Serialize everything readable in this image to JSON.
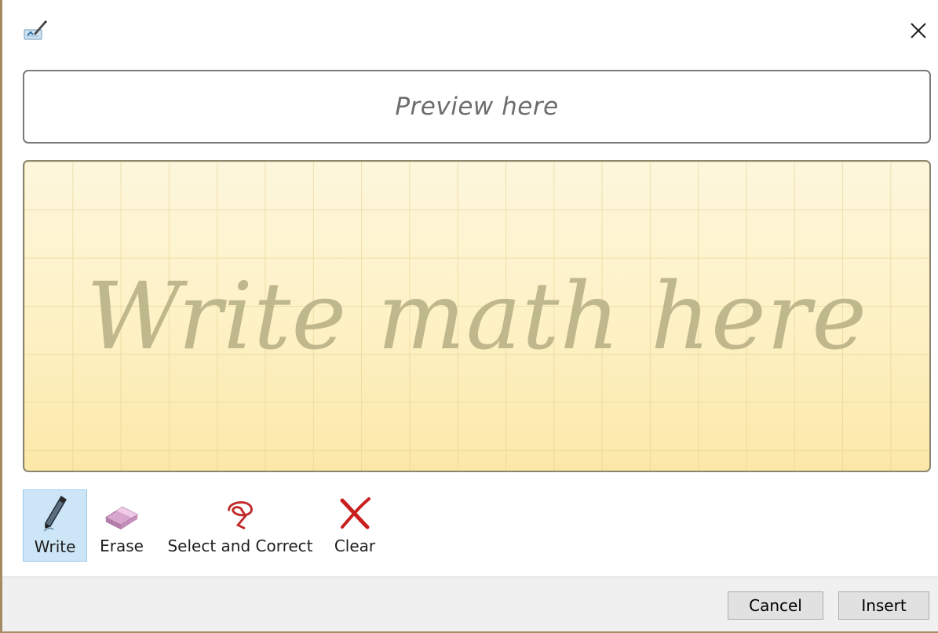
{
  "window": {
    "close_icon": "close-icon",
    "app_icon": "math-input-icon"
  },
  "preview": {
    "placeholder": "Preview here"
  },
  "write_area": {
    "hint": "Write math here"
  },
  "toolbar": {
    "active_tool": "write",
    "tools": [
      {
        "id": "write",
        "label": "Write",
        "icon": "pen-icon"
      },
      {
        "id": "erase",
        "label": "Erase",
        "icon": "eraser-icon"
      },
      {
        "id": "select_correct",
        "label": "Select and Correct",
        "icon": "lasso-icon"
      },
      {
        "id": "clear",
        "label": "Clear",
        "icon": "x-icon"
      }
    ]
  },
  "footer": {
    "cancel_label": "Cancel",
    "insert_label": "Insert"
  },
  "colors": {
    "write_area_bg": "#fdf2c6",
    "hint_text": "#bdb58a",
    "active_tool_bg": "#cde6f7"
  }
}
